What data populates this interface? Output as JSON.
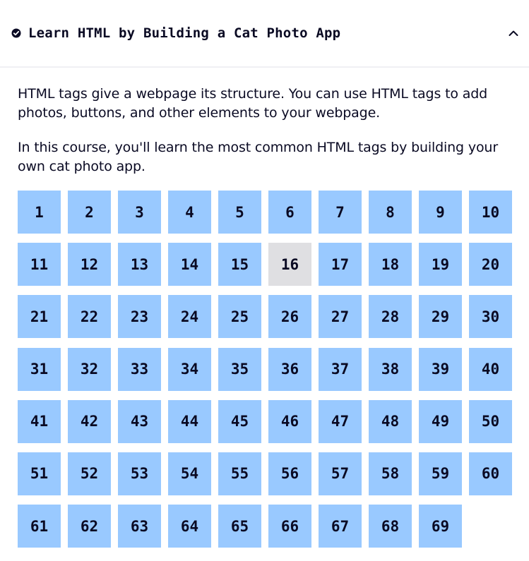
{
  "block": {
    "title": "Learn HTML by Building a Cat Photo App",
    "completed_icon": "check-circle-icon",
    "toggle_icon": "chevron-up-icon"
  },
  "description": [
    "HTML tags give a webpage its structure. You can use HTML tags to add photos, buttons, and other elements to your webpage.",
    "In this course, you'll learn the most common HTML tags by building your own cat photo app."
  ],
  "steps": [
    "1",
    "2",
    "3",
    "4",
    "5",
    "6",
    "7",
    "8",
    "9",
    "10",
    "11",
    "12",
    "13",
    "14",
    "15",
    "16",
    "17",
    "18",
    "19",
    "20",
    "21",
    "22",
    "23",
    "24",
    "25",
    "26",
    "27",
    "28",
    "29",
    "30",
    "31",
    "32",
    "33",
    "34",
    "35",
    "36",
    "37",
    "38",
    "39",
    "40",
    "41",
    "42",
    "43",
    "44",
    "45",
    "46",
    "47",
    "48",
    "49",
    "50",
    "51",
    "52",
    "53",
    "54",
    "55",
    "56",
    "57",
    "58",
    "59",
    "60",
    "61",
    "62",
    "63",
    "64",
    "65",
    "66",
    "67",
    "68",
    "69"
  ],
  "current_step": "16",
  "colors": {
    "step_bg": "#99c9ff",
    "current_step_bg": "#dfdfe2",
    "text": "#0a0a23"
  }
}
